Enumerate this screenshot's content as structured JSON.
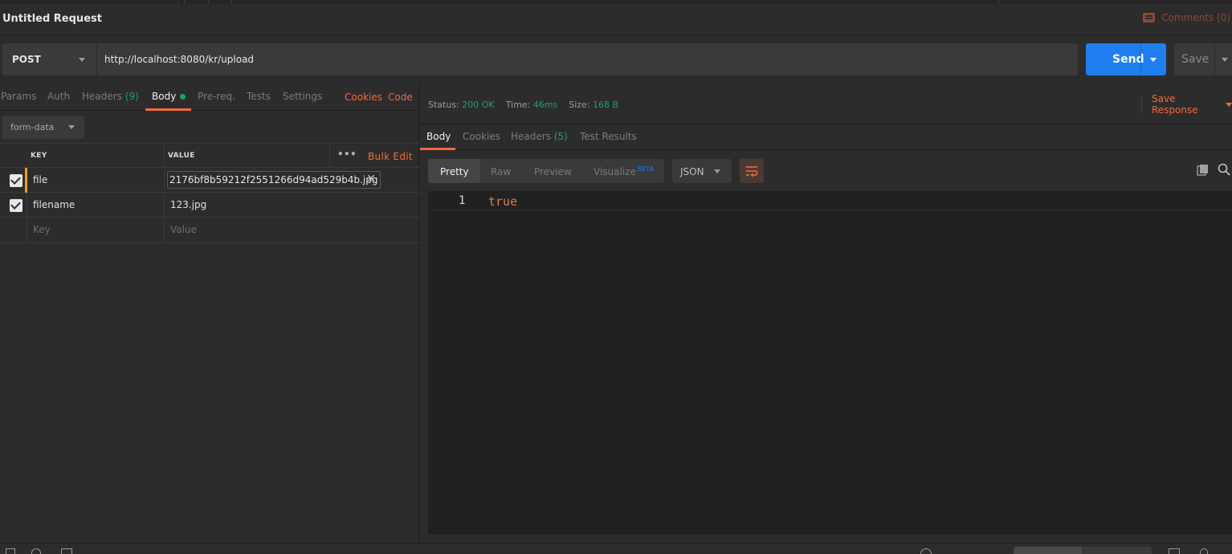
{
  "window": {
    "title": "Untitled Request",
    "comments_label": "Comments (0)"
  },
  "request": {
    "method": "POST",
    "url": "http://localhost:8080/kr/upload",
    "send_label": "Send",
    "save_label": "Save"
  },
  "request_tabs": {
    "params": "Params",
    "auth": "Auth",
    "headers": "Headers",
    "headers_count": "(9)",
    "body": "Body",
    "prereq": "Pre-req.",
    "tests": "Tests",
    "settings": "Settings",
    "cookies": "Cookies",
    "code": "Code"
  },
  "body": {
    "mode": "form-data",
    "columns": {
      "key": "KEY",
      "value": "VALUE",
      "more": "•••",
      "bulk_edit": "Bulk Edit"
    },
    "rows": [
      {
        "checked": true,
        "key": "file",
        "value": "2176bf8b59212f2551266d94ad529b4b.jpg",
        "type": "file"
      },
      {
        "checked": true,
        "key": "filename",
        "value": "123.jpg",
        "type": "text"
      }
    ],
    "placeholder": {
      "key": "Key",
      "value": "Value"
    }
  },
  "response": {
    "status_label": "Status:",
    "status_value": "200 OK",
    "time_label": "Time:",
    "time_value": "46ms",
    "size_label": "Size:",
    "size_value": "168 B",
    "save_response": "Save Response",
    "tabs": {
      "body": "Body",
      "cookies": "Cookies",
      "headers": "Headers",
      "headers_count": "(5)",
      "test_results": "Test Results"
    },
    "formats": {
      "pretty": "Pretty",
      "raw": "Raw",
      "preview": "Preview",
      "visualize": "Visualize",
      "beta": "BETA"
    },
    "language": "JSON",
    "line_number": "1",
    "content": "true"
  },
  "colors": {
    "accent": "#f26b3a",
    "send": "#1f7ef0",
    "success": "#22a06b",
    "background": "#2c2c2c"
  }
}
